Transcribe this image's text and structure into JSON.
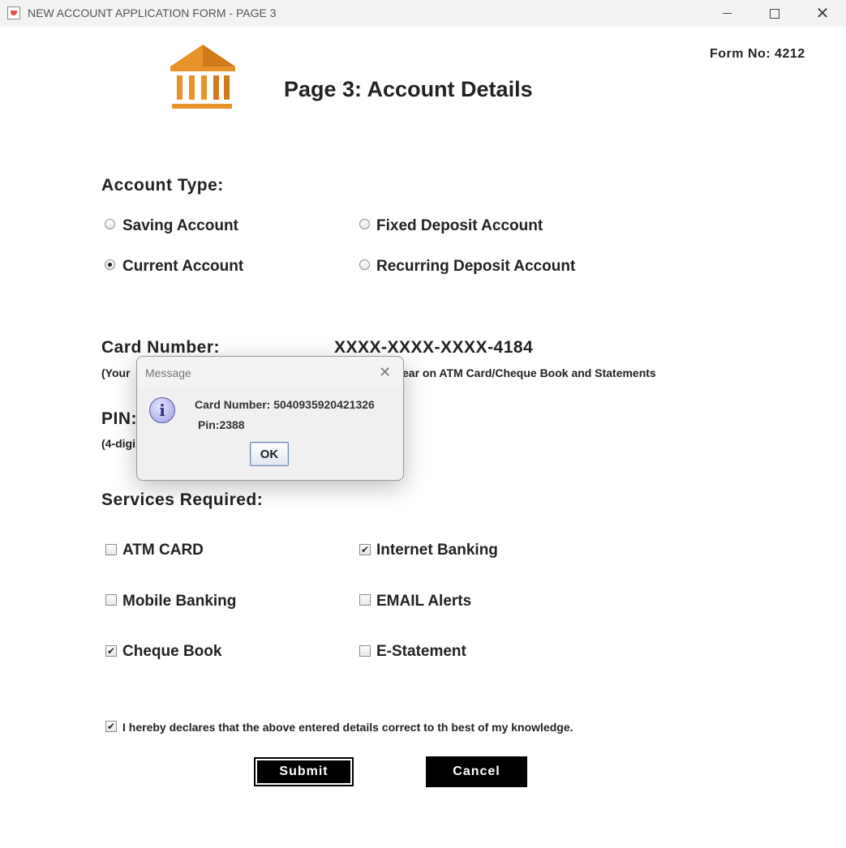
{
  "window": {
    "title": "NEW ACCOUNT APPLICATION FORM - PAGE 3",
    "icon": "java-cup-icon"
  },
  "header": {
    "form_no": "Form No: 4212",
    "page_title": "Page 3: Account Details",
    "logo": "bank-building-icon",
    "logo_color": "#E8922A"
  },
  "account_type": {
    "heading": "Account Type:",
    "options": [
      {
        "label": "Saving Account",
        "selected": false
      },
      {
        "label": "Fixed Deposit Account",
        "selected": false
      },
      {
        "label": "Current Account",
        "selected": true
      },
      {
        "label": "Recurring Deposit Account",
        "selected": false
      }
    ]
  },
  "card": {
    "label": "Card Number:",
    "value": "XXXX-XXXX-XXXX-4184",
    "hint_left": "(Your",
    "hint_right": "ear on ATM Card/Cheque Book and Statements"
  },
  "pin": {
    "label": "PIN:",
    "hint": "(4-digi"
  },
  "services": {
    "heading": "Services Required:",
    "items": [
      {
        "label": "ATM CARD",
        "checked": false
      },
      {
        "label": "Internet Banking",
        "checked": true
      },
      {
        "label": "Mobile Banking",
        "checked": false
      },
      {
        "label": "EMAIL Alerts",
        "checked": false
      },
      {
        "label": "Cheque Book",
        "checked": true
      },
      {
        "label": "E-Statement",
        "checked": false
      }
    ]
  },
  "declaration": {
    "text": "I hereby declares that the above entered details correct to th best of my knowledge.",
    "checked": true
  },
  "buttons": {
    "submit": "Submit",
    "cancel": "Cancel"
  },
  "dialog": {
    "title": "Message",
    "card_line": "Card Number: 5040935920421326",
    "pin_line": "Pin:2388",
    "ok": "OK",
    "icon": "info-icon"
  },
  "colors": {
    "accent": "#E8922A",
    "button_bg": "#000000"
  }
}
